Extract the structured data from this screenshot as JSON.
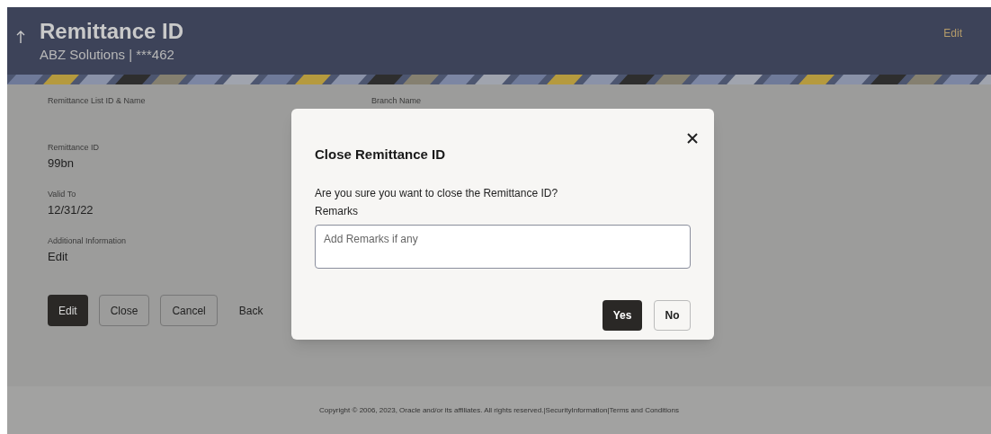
{
  "header": {
    "title": "Remittance ID",
    "subtitle": "ABZ Solutions | ***462",
    "action": "Edit"
  },
  "details": [
    {
      "label": "Remittance List ID & Name"
    },
    {
      "label": "Remittance ID",
      "value": "99bn"
    },
    {
      "label": "Valid To",
      "value": "12/31/22"
    },
    {
      "label": "Additional Information",
      "value": "Edit"
    }
  ],
  "branch_label": "Branch Name",
  "actions": [
    {
      "label": "Edit",
      "kind": "primary"
    },
    {
      "label": "Close",
      "kind": "outline"
    },
    {
      "label": "Cancel",
      "kind": "outline"
    },
    {
      "label": "Back",
      "kind": "link"
    }
  ],
  "dialog": {
    "title": "Close Remittance ID",
    "message": "Are you sure you want to close the Remittance ID?",
    "field_label": "Remarks",
    "placeholder": "Add Remarks if any",
    "buttons": [
      {
        "label": "Yes",
        "kind": "primary"
      },
      {
        "label": "No",
        "kind": "outline"
      }
    ]
  },
  "footer": {
    "copyright": "Copyright © 2006, 2023, Oracle and/or its affiliates. All rights reserved.",
    "separator": "|",
    "links": [
      "SecurityInformation",
      "Terms and Conditions"
    ]
  }
}
